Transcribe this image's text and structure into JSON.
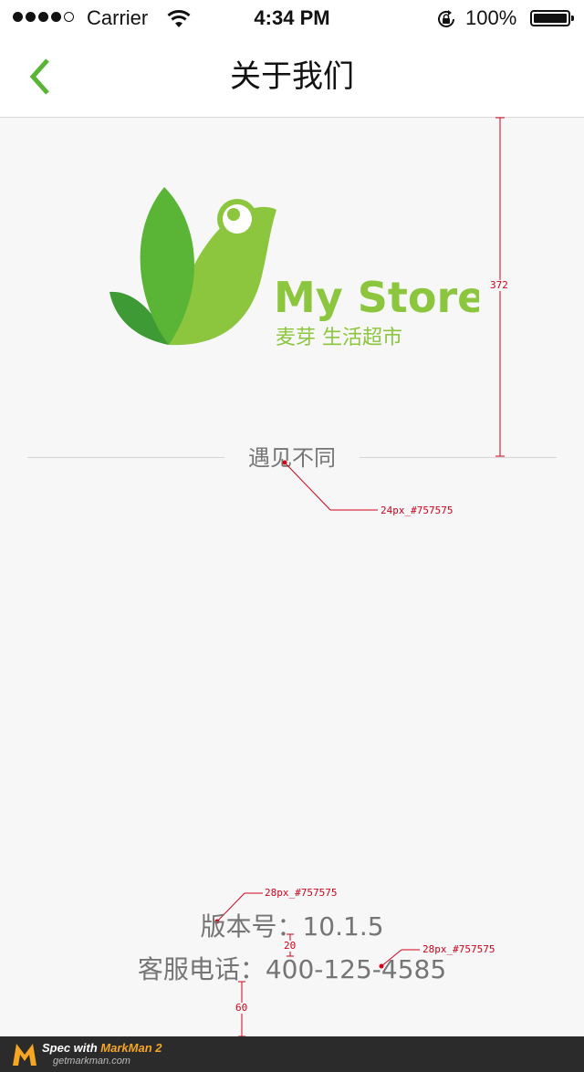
{
  "status_bar": {
    "carrier": "Carrier",
    "time": "4:34 PM",
    "battery": "100%"
  },
  "nav": {
    "title": "关于我们",
    "accent_color": "#5ab435"
  },
  "logo": {
    "brand": "My Store",
    "subtitle": "麦芽 生活超市",
    "brand_color": "#8cc63f"
  },
  "slogan": "遇见不同",
  "info": {
    "version": "版本号：10.1.5",
    "phone": "客服电话：400-125-4585",
    "text_color": "#757575"
  },
  "annotations": {
    "height_372": "372",
    "slogan_spec": "24px_#757575",
    "version_spec": "28px_#757575",
    "phone_spec": "28px_#757575",
    "gap_20": "20",
    "gap_60": "60"
  },
  "markman": {
    "prefix": "Spec with ",
    "brand": "MarkMan 2",
    "site": "getmarkman.com"
  }
}
